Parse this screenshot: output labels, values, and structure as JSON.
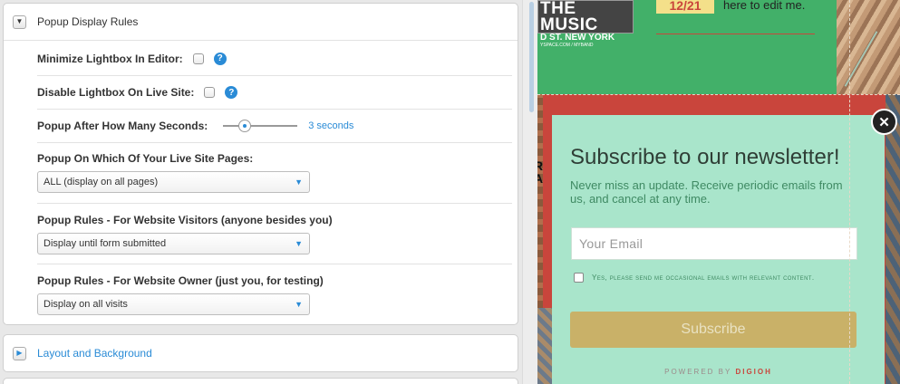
{
  "settings": {
    "section_title": "Popup Display Rules",
    "toggle_expanded": "▼",
    "toggle_collapsed": "▶",
    "rows": {
      "minimize": {
        "label": "Minimize Lightbox In Editor:",
        "help": "?"
      },
      "disable": {
        "label": "Disable Lightbox On Live Site:",
        "help": "?"
      },
      "delay": {
        "label": "Popup After How Many Seconds:",
        "value_text": "3 seconds",
        "slider_fraction": 0.25
      },
      "pages": {
        "label": "Popup On Which Of Your Live Site Pages:",
        "selected": "ALL (display on all pages)"
      },
      "visitors": {
        "label": "Popup Rules - For Website Visitors (anyone besides you)",
        "selected": "Display until form submitted"
      },
      "owner": {
        "label": "Popup Rules - For Website Owner (just you, for testing)",
        "selected": "Display on all visits"
      }
    },
    "select_arrow": "▼",
    "collapsed_section_title": "Layout and Background"
  },
  "preview": {
    "music_box": {
      "line1": "THE MUSIC",
      "line2": "D ST.   NEW YORK",
      "line3": "YSPACE.COM / MYBAND"
    },
    "date_tag": "12/21",
    "edit_text": "here to edit me.",
    "edge_text": "R\nA",
    "popup": {
      "title": "Subscribe to our newsletter!",
      "subtitle": "Never miss an update. Receive periodic emails from us, and cancel at any time.",
      "email_placeholder": "Your Email",
      "consent": "Yes, please send me occasional emails with relevant content.",
      "button": "Subscribe",
      "powered_by": "POWERED BY",
      "brand": "DIGIOH",
      "close": "✕"
    }
  },
  "colors": {
    "accent_blue": "#2a8bd6",
    "popup_bg": "#a9e5cb",
    "subscribe_bg": "#c9b168",
    "page_red": "#c9453c",
    "page_green": "#42b069"
  }
}
